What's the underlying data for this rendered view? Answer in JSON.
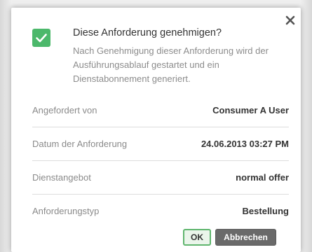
{
  "dialog": {
    "title": "Diese Anforderung genehmigen?",
    "description": "Nach Genehmigung dieser Anforderung wird der Ausführungsablauf gestartet und ein Dienstabonnement generiert.",
    "close_icon": "close-icon",
    "status_icon": "checkbox-checked-icon"
  },
  "details": [
    {
      "label": "Angefordert von",
      "value": "Consumer A User"
    },
    {
      "label": "Datum der Anforderung",
      "value": "24.06.2013 03:27 PM"
    },
    {
      "label": "Dienstangebot",
      "value": "normal offer"
    },
    {
      "label": "Anforderungstyp",
      "value": "Bestellung"
    }
  ],
  "buttons": {
    "ok_label": "OK",
    "cancel_label": "Abbrechen"
  },
  "colors": {
    "accent_green": "#4cb86b",
    "cancel_gray": "#6a6a6a"
  }
}
